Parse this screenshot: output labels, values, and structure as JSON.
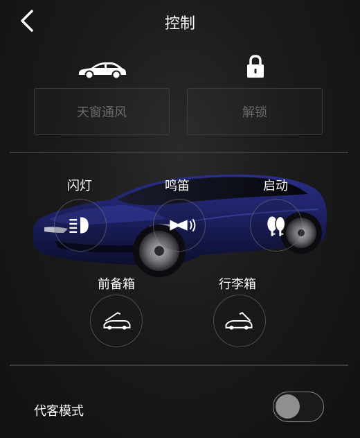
{
  "header": {
    "title": "控制",
    "back_icon": "chevron-left-icon"
  },
  "top_actions": {
    "sunroof": {
      "icon": "car-side-icon",
      "label": "天窗通风"
    },
    "unlock": {
      "icon": "lock-icon",
      "label": "解锁"
    }
  },
  "controls": {
    "flash": {
      "label": "闪灯",
      "icon": "headlight-icon"
    },
    "horn": {
      "label": "鸣笛",
      "icon": "horn-icon"
    },
    "start": {
      "label": "启动",
      "icon": "key-fob-icon"
    },
    "frunk": {
      "label": "前备箱",
      "icon": "frunk-open-icon"
    },
    "trunk": {
      "label": "行李箱",
      "icon": "trunk-open-icon"
    }
  },
  "valet": {
    "label": "代客模式",
    "enabled": false
  },
  "colors": {
    "background": "#1a1a1b",
    "car_body": "#1b1f5e",
    "button_border": "#3d3d40",
    "muted_text": "#6a6a6d",
    "toggle_knob": "#8f8f92"
  }
}
